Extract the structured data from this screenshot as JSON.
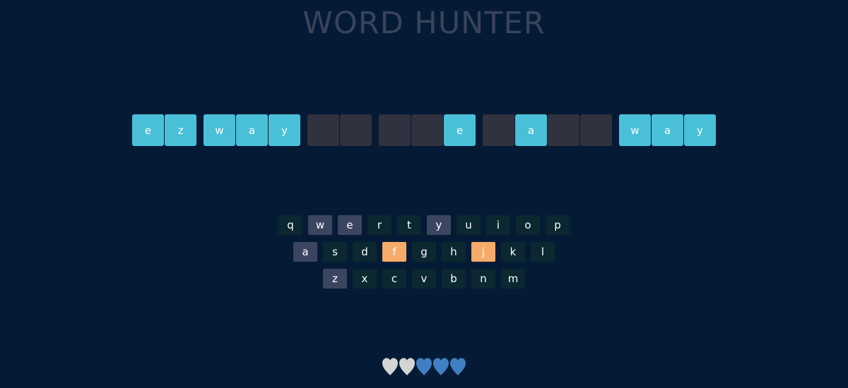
{
  "title": "WORD HUNTER",
  "board": {
    "words": [
      [
        {
          "letter": "e",
          "revealed": true
        },
        {
          "letter": "z",
          "revealed": true
        }
      ],
      [
        {
          "letter": "w",
          "revealed": true
        },
        {
          "letter": "a",
          "revealed": true
        },
        {
          "letter": "y",
          "revealed": true
        }
      ],
      [
        {
          "letter": "",
          "revealed": false
        },
        {
          "letter": "",
          "revealed": false
        }
      ],
      [
        {
          "letter": "",
          "revealed": false
        },
        {
          "letter": "",
          "revealed": false
        },
        {
          "letter": "e",
          "revealed": true
        }
      ],
      [
        {
          "letter": "",
          "revealed": false
        },
        {
          "letter": "a",
          "revealed": true
        },
        {
          "letter": "",
          "revealed": false
        },
        {
          "letter": "",
          "revealed": false
        }
      ],
      [
        {
          "letter": "w",
          "revealed": true
        },
        {
          "letter": "a",
          "revealed": true
        },
        {
          "letter": "y",
          "revealed": true
        }
      ]
    ]
  },
  "keyboard": {
    "rows": [
      [
        {
          "key": "q",
          "state": "unused"
        },
        {
          "key": "w",
          "state": "used"
        },
        {
          "key": "e",
          "state": "used"
        },
        {
          "key": "r",
          "state": "unused"
        },
        {
          "key": "t",
          "state": "unused"
        },
        {
          "key": "y",
          "state": "used"
        },
        {
          "key": "u",
          "state": "unused"
        },
        {
          "key": "i",
          "state": "unused"
        },
        {
          "key": "o",
          "state": "unused"
        },
        {
          "key": "p",
          "state": "unused"
        }
      ],
      [
        {
          "key": "a",
          "state": "used"
        },
        {
          "key": "s",
          "state": "unused"
        },
        {
          "key": "d",
          "state": "unused"
        },
        {
          "key": "f",
          "state": "wrong"
        },
        {
          "key": "g",
          "state": "unused"
        },
        {
          "key": "h",
          "state": "unused"
        },
        {
          "key": "j",
          "state": "wrong"
        },
        {
          "key": "k",
          "state": "unused"
        },
        {
          "key": "l",
          "state": "unused"
        }
      ],
      [
        {
          "key": "z",
          "state": "used"
        },
        {
          "key": "x",
          "state": "unused"
        },
        {
          "key": "c",
          "state": "unused"
        },
        {
          "key": "v",
          "state": "unused"
        },
        {
          "key": "b",
          "state": "unused"
        },
        {
          "key": "n",
          "state": "unused"
        },
        {
          "key": "m",
          "state": "unused"
        }
      ]
    ]
  },
  "lives": {
    "total": 5,
    "remaining": 3,
    "lost_color": "#d4d4d4",
    "remaining_color": "#3f7fc4"
  }
}
